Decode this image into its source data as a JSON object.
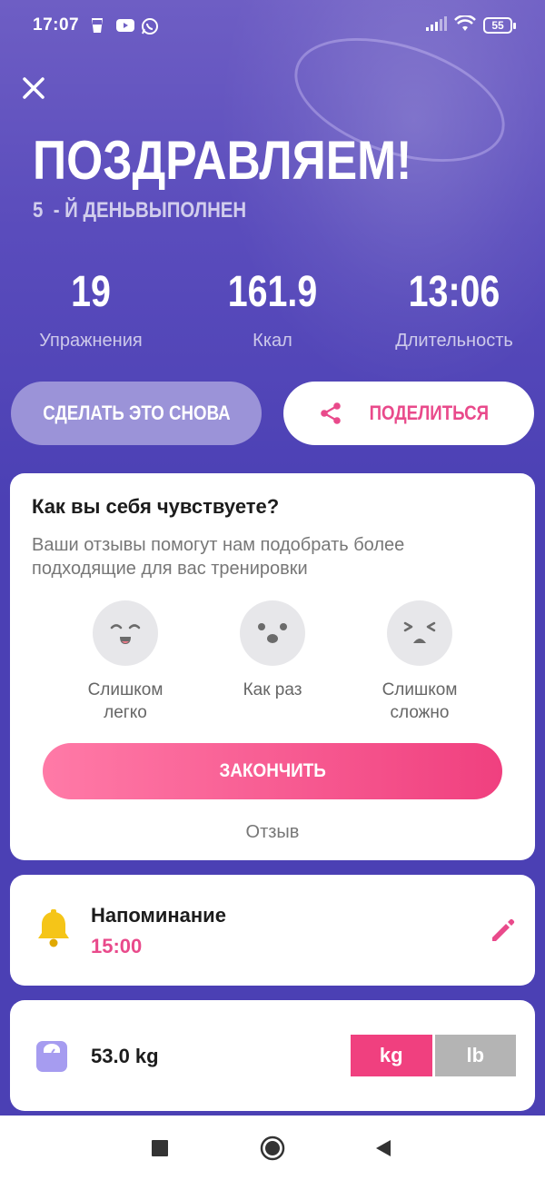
{
  "status_bar": {
    "time": "17:07",
    "battery": "55",
    "left_icons": [
      "glass-icon",
      "youtube-icon",
      "whatsapp-icon"
    ],
    "right_icons": [
      "signal-icon",
      "wifi-icon",
      "battery-icon"
    ]
  },
  "hero": {
    "title": "ПОЗДРАВЛЯЕМ!",
    "day_number": "5",
    "day_suffix": "- Й ДЕНЬВЫПОЛНЕН"
  },
  "stats": [
    {
      "value": "19",
      "label": "Упражнения"
    },
    {
      "value": "161.9",
      "label": "Ккал"
    },
    {
      "value": "13:06",
      "label": "Длительность"
    }
  ],
  "buttons": {
    "again": "СДЕЛАТЬ ЭТО СНОВА",
    "share": "ПОДЕЛИТЬСЯ"
  },
  "feedback": {
    "title": "Как вы себя чувствуете?",
    "description": "Ваши отзывы помогут нам подобрать более подходящие для вас тренировки",
    "moods": [
      {
        "label_line1": "Слишком",
        "label_line2": "легко"
      },
      {
        "label_line1": "Как раз",
        "label_line2": ""
      },
      {
        "label_line1": "Слишком",
        "label_line2": "сложно"
      }
    ],
    "finish_button": "ЗАКОНЧИТЬ",
    "feedback_link": "Отзыв"
  },
  "reminder": {
    "title": "Напоминание",
    "time": "15:00"
  },
  "weight": {
    "value": "53.0  kg",
    "units": [
      "kg",
      "lb"
    ],
    "selected_unit": "kg"
  },
  "colors": {
    "accent": "#f0407f",
    "primary": "#4b40b4",
    "secondary_button": "#9b93d8"
  }
}
